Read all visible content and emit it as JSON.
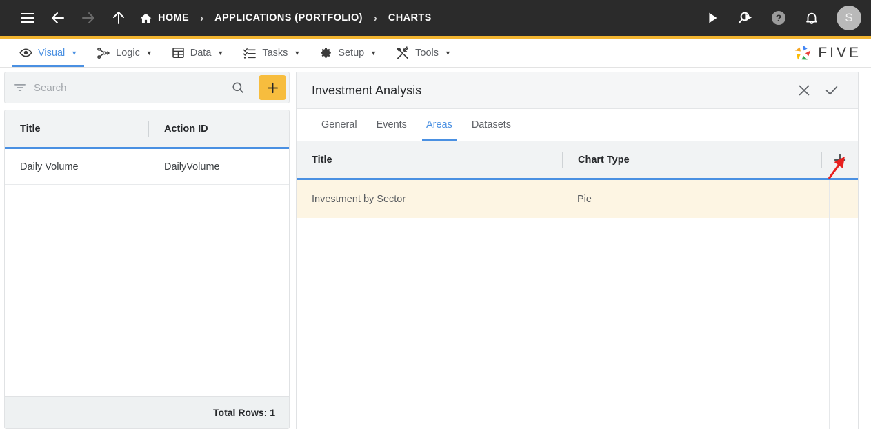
{
  "topbar": {
    "icons": {
      "menu": "hamburger-menu-icon",
      "back": "arrow-back-icon",
      "forward": "arrow-forward-icon",
      "up": "arrow-up-icon",
      "run": "play-icon",
      "search_run": "search-play-icon",
      "help": "help-circle-icon",
      "notifications": "bell-icon"
    },
    "breadcrumbs": [
      {
        "label": "HOME",
        "icon": "home-icon"
      },
      {
        "label": "APPLICATIONS (PORTFOLIO)",
        "icon": ""
      },
      {
        "label": "CHARTS",
        "icon": ""
      }
    ],
    "separator": "›",
    "avatar_initial": "S",
    "accent_color": "#f2b530",
    "background_color": "#2b2b2b"
  },
  "menubar": {
    "items": [
      {
        "label": "Visual",
        "icon": "eye-icon",
        "caret": "▼",
        "active": true
      },
      {
        "label": "Logic",
        "icon": "node-graph-icon",
        "caret": "▼",
        "active": false
      },
      {
        "label": "Data",
        "icon": "table-grid-icon",
        "caret": "▼",
        "active": false
      },
      {
        "label": "Tasks",
        "icon": "checklist-icon",
        "caret": "▼",
        "active": false
      },
      {
        "label": "Setup",
        "icon": "gear-icon",
        "caret": "▼",
        "active": false
      },
      {
        "label": "Tools",
        "icon": "tools-icon",
        "caret": "▼",
        "active": false
      }
    ],
    "brand": {
      "text": "FIVE",
      "logo": "five-pinwheel-logo"
    },
    "active_color": "#4a90e2"
  },
  "left_panel": {
    "search": {
      "placeholder": "Search",
      "value": "",
      "filter_icon": "filter-icon",
      "search_icon": "search-icon",
      "add_icon": "plus-icon",
      "add_button_color": "#f7bd3e"
    },
    "grid": {
      "columns": [
        "Title",
        "Action ID"
      ],
      "rows": [
        {
          "title": "Daily Volume",
          "action_id": "DailyVolume"
        }
      ],
      "footer": "Total Rows: 1"
    }
  },
  "right_panel": {
    "title": "Investment Analysis",
    "actions": {
      "close": "close-icon",
      "confirm": "check-icon"
    },
    "tabs": [
      {
        "label": "General",
        "active": false
      },
      {
        "label": "Events",
        "active": false
      },
      {
        "label": "Areas",
        "active": true
      },
      {
        "label": "Datasets",
        "active": false
      }
    ],
    "grid": {
      "columns": [
        "Title",
        "Chart Type"
      ],
      "add_icon": "plus-icon",
      "rows": [
        {
          "title": "Investment by Sector",
          "chart_type": "Pie"
        }
      ],
      "selected_row_color": "#fdf5e3"
    }
  },
  "annotation": {
    "arrow": {
      "color": "#e8201f",
      "points_to": "add-area-row-button"
    }
  }
}
